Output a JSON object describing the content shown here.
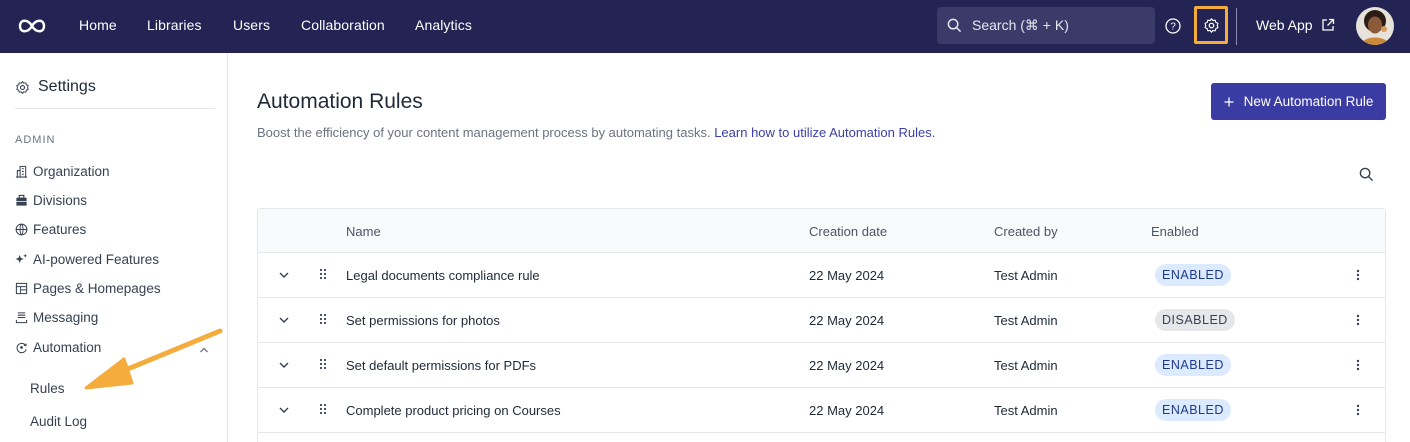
{
  "nav": {
    "links": [
      "Home",
      "Libraries",
      "Users",
      "Collaboration",
      "Analytics"
    ],
    "search_placeholder": "Search (⌘ + K)",
    "web_app": "Web App"
  },
  "sidebar": {
    "title": "Settings",
    "section": "ADMIN",
    "items": [
      {
        "label": "Organization",
        "icon": "building-icon"
      },
      {
        "label": "Divisions",
        "icon": "briefcase-icon"
      },
      {
        "label": "Features",
        "icon": "globe-icon"
      },
      {
        "label": "AI-powered Features",
        "icon": "sparkle-icon"
      },
      {
        "label": "Pages & Homepages",
        "icon": "layout-icon"
      },
      {
        "label": "Messaging",
        "icon": "inbox-icon"
      },
      {
        "label": "Automation",
        "icon": "automation-icon"
      }
    ],
    "sub_items": [
      "Rules",
      "Audit Log"
    ]
  },
  "main": {
    "title": "Automation Rules",
    "subtitle": "Boost the efficiency of your content management process by automating tasks.",
    "subtitle_link": "Learn how to utilize Automation Rules.",
    "new_button": "New Automation Rule",
    "table": {
      "headers": [
        "Name",
        "Creation date",
        "Created by",
        "Enabled"
      ],
      "rows": [
        {
          "name": "Legal documents compliance rule",
          "date": "22 May 2024",
          "by": "Test Admin",
          "status": "ENABLED"
        },
        {
          "name": "Set permissions for photos",
          "date": "22 May 2024",
          "by": "Test Admin",
          "status": "DISABLED"
        },
        {
          "name": "Set default permissions for PDFs",
          "date": "22 May 2024",
          "by": "Test Admin",
          "status": "ENABLED"
        },
        {
          "name": "Complete product pricing on Courses",
          "date": "22 May 2024",
          "by": "Test Admin",
          "status": "ENABLED"
        }
      ]
    }
  },
  "colors": {
    "nav_bg": "#232454",
    "primary": "#3a3ca3",
    "highlight": "#f4ac3d"
  }
}
